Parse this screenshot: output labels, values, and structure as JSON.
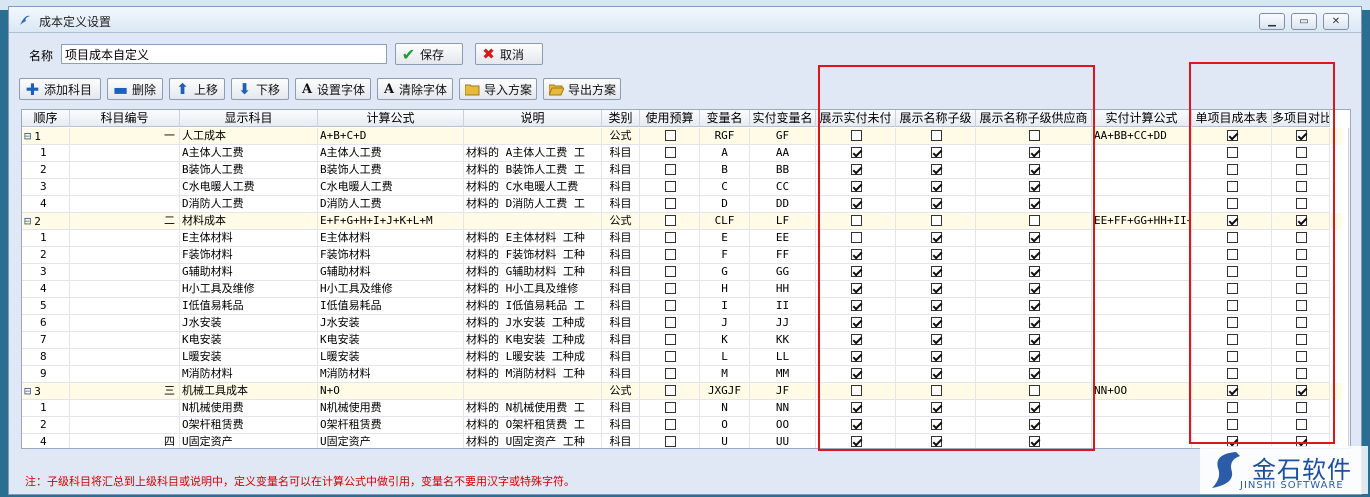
{
  "window": {
    "title": "成本定义设置"
  },
  "name": {
    "label": "名称",
    "value": "项目成本自定义"
  },
  "buttons": {
    "save": "保存",
    "cancel": "取消"
  },
  "toolbar": {
    "add": "添加科目",
    "delete": "删除",
    "up": "上移",
    "down": "下移",
    "set_font": "设置字体",
    "clear_font": "清除字体",
    "import": "导入方案",
    "export": "导出方案"
  },
  "columns": [
    "顺序",
    "科目编号",
    "显示科目",
    "计算公式",
    "说明",
    "类别",
    "使用预算",
    "变量名",
    "实付变量名",
    "展示实付未付",
    "展示名称子级",
    "展示名称子级供应商",
    "实付计算公式",
    "单项目成本表",
    "多项目对比"
  ],
  "rows": [
    {
      "order": "1",
      "code": "一",
      "name": "人工成本",
      "formula": "A+B+C+D",
      "desc": "",
      "type": "公式",
      "budget": false,
      "var": "RGF",
      "pvar": "GF",
      "c1": false,
      "c2": false,
      "c3": false,
      "pformula": "AA+BB+CC+DD",
      "s1": true,
      "s2": true,
      "parent": true
    },
    {
      "order": "1",
      "code": "",
      "name": "A主体人工费",
      "formula": "A主体人工费",
      "desc": "材料的 A主体人工费 工",
      "type": "科目",
      "budget": false,
      "var": "A",
      "pvar": "AA",
      "c1": true,
      "c2": true,
      "c3": true,
      "pformula": "",
      "s1": false,
      "s2": false,
      "parent": false
    },
    {
      "order": "2",
      "code": "",
      "name": "B装饰人工费",
      "formula": "B装饰人工费",
      "desc": "材料的 B装饰人工费 工",
      "type": "科目",
      "budget": false,
      "var": "B",
      "pvar": "BB",
      "c1": true,
      "c2": true,
      "c3": true,
      "pformula": "",
      "s1": false,
      "s2": false,
      "parent": false
    },
    {
      "order": "3",
      "code": "",
      "name": "C水电暖人工费",
      "formula": "C水电暖人工费",
      "desc": "材料的 C水电暖人工费",
      "type": "科目",
      "budget": false,
      "var": "C",
      "pvar": "CC",
      "c1": true,
      "c2": true,
      "c3": true,
      "pformula": "",
      "s1": false,
      "s2": false,
      "parent": false
    },
    {
      "order": "4",
      "code": "",
      "name": "D消防人工费",
      "formula": "D消防人工费",
      "desc": "材料的 D消防人工费 工",
      "type": "科目",
      "budget": false,
      "var": "D",
      "pvar": "DD",
      "c1": true,
      "c2": true,
      "c3": true,
      "pformula": "",
      "s1": false,
      "s2": false,
      "parent": false
    },
    {
      "order": "2",
      "code": "二",
      "name": "材料成本",
      "formula": "E+F+G+H+I+J+K+L+M",
      "desc": "",
      "type": "公式",
      "budget": false,
      "var": "CLF",
      "pvar": "LF",
      "c1": false,
      "c2": false,
      "c3": false,
      "pformula": "EE+FF+GG+HH+II+",
      "s1": true,
      "s2": true,
      "parent": true
    },
    {
      "order": "1",
      "code": "",
      "name": "E主体材料",
      "formula": "E主体材料",
      "desc": "材料的 E主体材料 工种",
      "type": "科目",
      "budget": false,
      "var": "E",
      "pvar": "EE",
      "c1": false,
      "c2": true,
      "c3": true,
      "pformula": "",
      "s1": false,
      "s2": false,
      "parent": false
    },
    {
      "order": "2",
      "code": "",
      "name": "F装饰材料",
      "formula": "F装饰材料",
      "desc": "材料的 F装饰材料 工种",
      "type": "科目",
      "budget": false,
      "var": "F",
      "pvar": "FF",
      "c1": true,
      "c2": true,
      "c3": true,
      "pformula": "",
      "s1": false,
      "s2": false,
      "parent": false
    },
    {
      "order": "3",
      "code": "",
      "name": "G辅助材料",
      "formula": "G辅助材料",
      "desc": "材料的 G辅助材料 工种",
      "type": "科目",
      "budget": false,
      "var": "G",
      "pvar": "GG",
      "c1": true,
      "c2": true,
      "c3": true,
      "pformula": "",
      "s1": false,
      "s2": false,
      "parent": false
    },
    {
      "order": "4",
      "code": "",
      "name": "H小工具及维修",
      "formula": "H小工具及维修",
      "desc": "材料的 H小工具及维修",
      "type": "科目",
      "budget": false,
      "var": "H",
      "pvar": "HH",
      "c1": true,
      "c2": true,
      "c3": true,
      "pformula": "",
      "s1": false,
      "s2": false,
      "parent": false
    },
    {
      "order": "5",
      "code": "",
      "name": "I低值易耗品",
      "formula": "I低值易耗品",
      "desc": "材料的 I低值易耗品 工",
      "type": "科目",
      "budget": false,
      "var": "I",
      "pvar": "II",
      "c1": true,
      "c2": true,
      "c3": true,
      "pformula": "",
      "s1": false,
      "s2": false,
      "parent": false
    },
    {
      "order": "6",
      "code": "",
      "name": "J水安装",
      "formula": "J水安装",
      "desc": "材料的 J水安装 工种成",
      "type": "科目",
      "budget": false,
      "var": "J",
      "pvar": "JJ",
      "c1": true,
      "c2": true,
      "c3": true,
      "pformula": "",
      "s1": false,
      "s2": false,
      "parent": false
    },
    {
      "order": "7",
      "code": "",
      "name": "K电安装",
      "formula": "K电安装",
      "desc": "材料的 K电安装 工种成",
      "type": "科目",
      "budget": false,
      "var": "K",
      "pvar": "KK",
      "c1": true,
      "c2": true,
      "c3": true,
      "pformula": "",
      "s1": false,
      "s2": false,
      "parent": false
    },
    {
      "order": "8",
      "code": "",
      "name": "L暖安装",
      "formula": "L暖安装",
      "desc": "材料的 L暖安装 工种成",
      "type": "科目",
      "budget": false,
      "var": "L",
      "pvar": "LL",
      "c1": true,
      "c2": true,
      "c3": true,
      "pformula": "",
      "s1": false,
      "s2": false,
      "parent": false
    },
    {
      "order": "9",
      "code": "",
      "name": "M消防材料",
      "formula": "M消防材料",
      "desc": "材料的 M消防材料 工种",
      "type": "科目",
      "budget": false,
      "var": "M",
      "pvar": "MM",
      "c1": true,
      "c2": true,
      "c3": true,
      "pformula": "",
      "s1": false,
      "s2": false,
      "parent": false
    },
    {
      "order": "3",
      "code": "三",
      "name": "机械工具成本",
      "formula": "N+O",
      "desc": "",
      "type": "公式",
      "budget": false,
      "var": "JXGJF",
      "pvar": "JF",
      "c1": false,
      "c2": false,
      "c3": false,
      "pformula": "NN+OO",
      "s1": true,
      "s2": true,
      "parent": true
    },
    {
      "order": "1",
      "code": "",
      "name": "N机械使用费",
      "formula": "N机械使用费",
      "desc": "材料的 N机械使用费 工",
      "type": "科目",
      "budget": false,
      "var": "N",
      "pvar": "NN",
      "c1": true,
      "c2": true,
      "c3": true,
      "pformula": "",
      "s1": false,
      "s2": false,
      "parent": false
    },
    {
      "order": "2",
      "code": "",
      "name": "O架杆租赁费",
      "formula": "O架杆租赁费",
      "desc": "材料的 O架杆租赁费 工",
      "type": "科目",
      "budget": false,
      "var": "O",
      "pvar": "OO",
      "c1": true,
      "c2": true,
      "c3": true,
      "pformula": "",
      "s1": false,
      "s2": false,
      "parent": false
    },
    {
      "order": "4",
      "code": "四",
      "name": "U固定资产",
      "formula": "U固定资产",
      "desc": "材料的 U固定资产 工种",
      "type": "科目",
      "budget": false,
      "var": "U",
      "pvar": "UU",
      "c1": true,
      "c2": true,
      "c3": true,
      "pformula": "",
      "s1": true,
      "s2": true,
      "parent": false
    }
  ],
  "note": "注：子级科目将汇总到上级科目或说明中，定义变量名可以在计算公式中做引用，变量名不要用汉字或特殊字符。",
  "logo": {
    "main": "金石软件",
    "sub": "JINSHI SOFTWARE"
  },
  "colors": {
    "parent_row": "#fffbe6",
    "highlight_box": "#e0141a",
    "note": "#d40000"
  }
}
